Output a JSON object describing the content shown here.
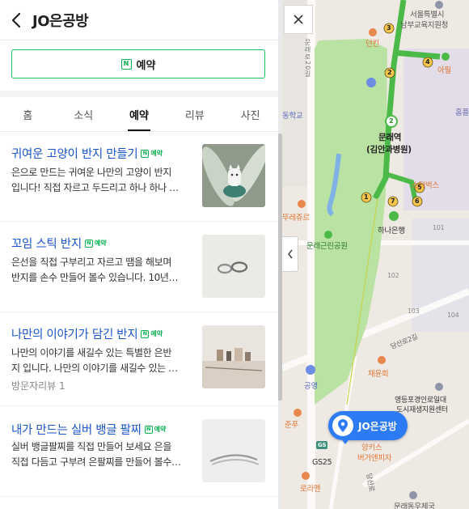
{
  "header": {
    "title": "JO은공방"
  },
  "reserve_button": {
    "icon_text": "N",
    "label": "예약"
  },
  "tabs": [
    {
      "label": "홈",
      "active": false
    },
    {
      "label": "소식",
      "active": false
    },
    {
      "label": "예약",
      "active": true
    },
    {
      "label": "리뷰",
      "active": false
    },
    {
      "label": "사진",
      "active": false
    }
  ],
  "items": [
    {
      "title": "귀여운 고양이 반지 만들기",
      "badge": "예약",
      "desc1": "은으로 만드는 귀여운 나만의 고양이 반지",
      "desc2": "입니다! 직접 자르고 두드리고 하나 하나 …",
      "meta": ""
    },
    {
      "title": "꼬임 스틱 반지",
      "badge": "예약",
      "desc1": "은선을 직접 구부리고 자르고 땜을 해보며",
      "desc2": "반지를 손수 만들어 볼수 있습니다. 10년…",
      "meta": ""
    },
    {
      "title": "나만의 이야기가 담긴 반지",
      "badge": "예약",
      "desc1": "나만의 이야기를 새길수 있는 특별한 은반",
      "desc2": "지 입니다. 나만의 이야기를 새길수 있는 …",
      "meta": "방문자리뷰 1"
    },
    {
      "title": "내가 만드는 실버 뱅글 팔찌",
      "badge": "예약",
      "desc1": "실버 뱅글팔찌를 직접 만들어 보세요 은을",
      "desc2": "직접 다듬고 구부려 은팔찌를 만들어 볼수…",
      "meta": ""
    }
  ],
  "map": {
    "labels": {
      "seoul_office": "서울특별시",
      "south_office": "남부교육지원청",
      "denkin": "던킨",
      "apple": "아필",
      "hall": "홈플",
      "road": "문래로20길",
      "school": "동학교",
      "station_name": "문래역",
      "station_sub": "(김안과병원)",
      "starbucks": "스타벅스",
      "tteok": "뚜레쥬르",
      "park": "문래근린공원",
      "hana": "하나은행",
      "b101": "101",
      "b102": "102",
      "b103": "103",
      "b104": "104",
      "road2": "당산로2길",
      "chae": "채윤희",
      "park2": "공영",
      "yeongdeungpo1": "영등포경인로일대",
      "yeongdeungpo2": "도시재생지원센터",
      "junpu": "준푸",
      "gs": "GS25",
      "gs_icon": "GS",
      "burger1": "양키스",
      "burger2": "버거앤피자",
      "lalaen": "로라멘",
      "road3": "당산로",
      "bottom": "문래동우체국",
      "exit_1": "1",
      "exit_2": "2",
      "exit_3": "3",
      "exit_4": "4",
      "exit_5": "5",
      "exit_6": "6",
      "exit_7": "7",
      "line_num": "2",
      "place": "JO은공방"
    },
    "colors": {
      "park": "#b9e2a3",
      "subway": "#4cba49",
      "pin": "#2d7af5",
      "land": "#efe9e4"
    }
  },
  "icons": [
    "back-arrow-icon",
    "close-icon",
    "chevron-left-icon",
    "location-pin-icon"
  ]
}
